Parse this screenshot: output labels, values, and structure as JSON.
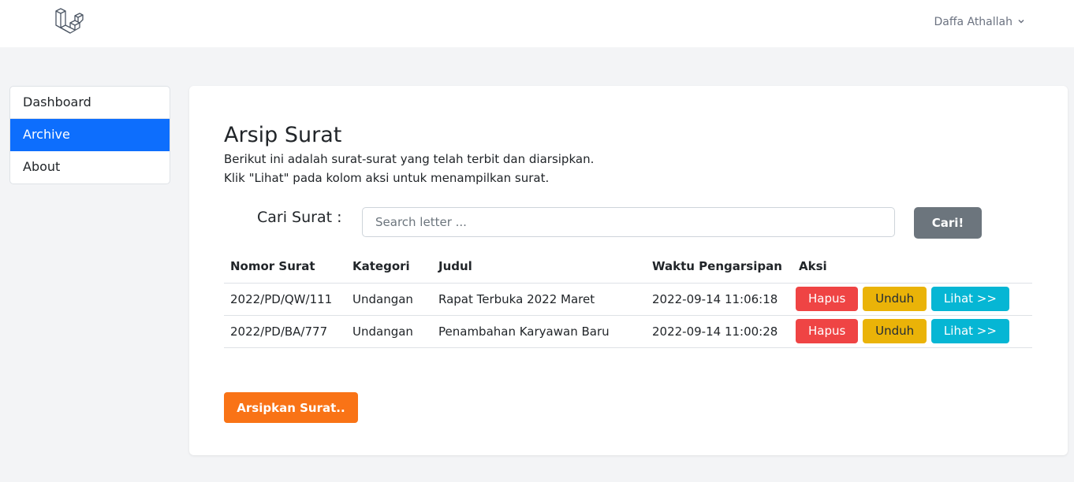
{
  "header": {
    "logo_icon": "laravel-logo-icon",
    "user_name": "Daffa Athallah",
    "dropdown_icon": "chevron-down-icon"
  },
  "sidebar": {
    "items": [
      {
        "label": "Dashboard",
        "active": false
      },
      {
        "label": "Archive",
        "active": true
      },
      {
        "label": "About",
        "active": false
      }
    ]
  },
  "main": {
    "title": "Arsip Surat",
    "description_line1": "Berikut ini adalah surat-surat yang telah terbit dan diarsipkan.",
    "description_line2": "Klik \"Lihat\" pada kolom aksi untuk menampilkan surat.",
    "search": {
      "label": "Cari Surat :",
      "placeholder": "Search letter ...",
      "button_label": "Cari!"
    },
    "table": {
      "columns": [
        "Nomor Surat",
        "Kategori",
        "Judul",
        "Waktu Pengarsipan",
        "Aksi"
      ],
      "rows": [
        {
          "nomor": "2022/PD/QW/111",
          "kategori": "Undangan",
          "judul": "Rapat Terbuka 2022 Maret",
          "waktu": "2022-09-14 11:06:18"
        },
        {
          "nomor": "2022/PD/BA/777",
          "kategori": "Undangan",
          "judul": "Penambahan Karyawan Baru",
          "waktu": "2022-09-14 11:00:28"
        }
      ],
      "actions": {
        "delete": "Hapus",
        "download": "Unduh",
        "view": "Lihat >>"
      }
    },
    "archive_button_label": "Arsipkan Surat.."
  },
  "colors": {
    "primary": "#0d6efd",
    "danger": "#ef4444",
    "warning": "#eab308",
    "info": "#06b6d4",
    "secondary": "#6c757d",
    "orange": "#f97316"
  }
}
